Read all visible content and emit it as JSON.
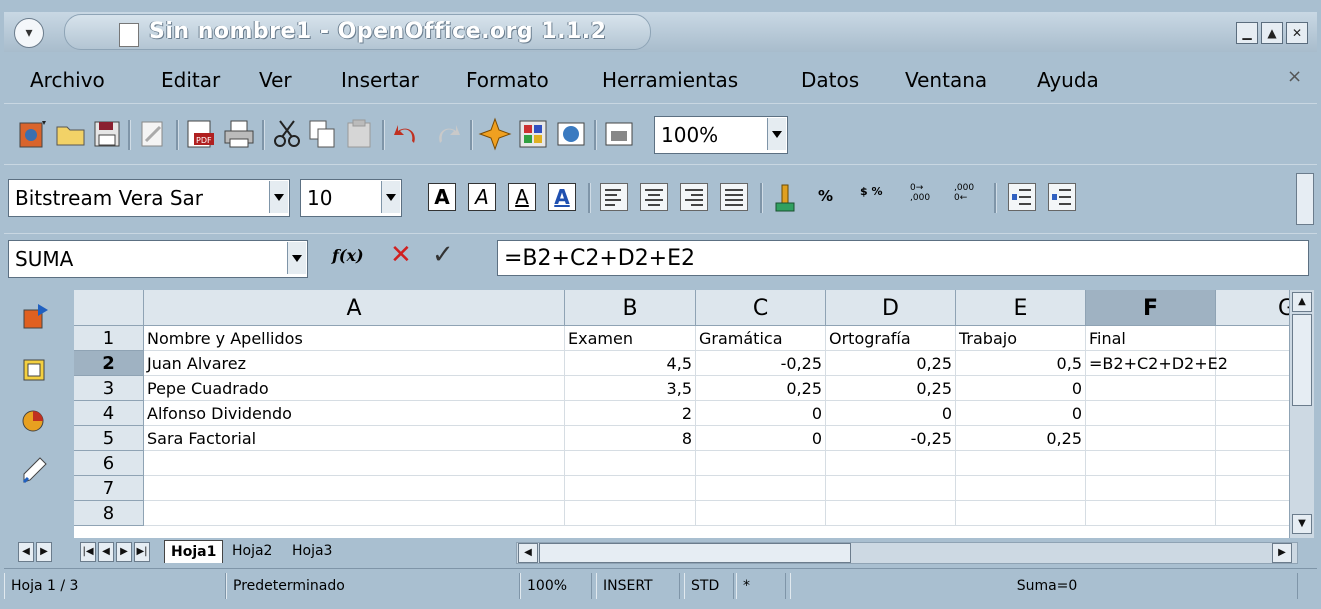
{
  "window": {
    "title": "Sin nombre1 - OpenOffice.org 1.1.2",
    "buttons": {
      "minimize": "▁",
      "maximize": "▲",
      "close": "✕"
    }
  },
  "menu": {
    "items": [
      "Archivo",
      "Editar",
      "Ver",
      "Insertar",
      "Formato",
      "Herramientas",
      "Datos",
      "Ventana",
      "Ayuda"
    ],
    "close": "×"
  },
  "toolbar": {
    "zoom": "100%"
  },
  "format_toolbar": {
    "font": "Bitstream Vera Sar",
    "size": "10",
    "text_buttons": [
      "A",
      "A",
      "A",
      "A"
    ],
    "percent": "%",
    "currency": "$ %",
    "decimal_add": "0→ ,000",
    "decimal_del": ",000 0←"
  },
  "formula_bar": {
    "name_box": "SUMA",
    "function_label": "f(x)",
    "cancel": "✕",
    "accept": "✓",
    "formula": "=B2+C2+D2+E2"
  },
  "sheet": {
    "columns": [
      "A",
      "B",
      "C",
      "D",
      "E",
      "F",
      "G"
    ],
    "selected_column": "F",
    "rows": [
      "1",
      "2",
      "3",
      "4",
      "5",
      "6",
      "7",
      "8"
    ],
    "selected_row": "2",
    "cells": [
      [
        "Nombre y Apellidos",
        "Examen",
        "Gramática",
        "Ortografía",
        "Trabajo",
        "Final"
      ],
      [
        "Juan Alvarez",
        "4,5",
        "-0,25",
        "0,25",
        "0,5",
        "=B2+C2+D2+E2"
      ],
      [
        "Pepe Cuadrado",
        "3,5",
        "0,25",
        "0,25",
        "0",
        ""
      ],
      [
        "Alfonso Dividendo",
        "2",
        "0",
        "0",
        "0",
        ""
      ],
      [
        "Sara Factorial",
        "8",
        "0",
        "-0,25",
        "0,25",
        ""
      ]
    ]
  },
  "tabs": {
    "items": [
      "Hoja1",
      "Hoja2",
      "Hoja3"
    ],
    "active": "Hoja1"
  },
  "status": {
    "sheet": "Hoja 1 / 3",
    "style": "Predeterminado",
    "zoom": "100%",
    "mode": "INSERT",
    "selection": "STD",
    "modified": "*",
    "sum": "Suma=0"
  }
}
